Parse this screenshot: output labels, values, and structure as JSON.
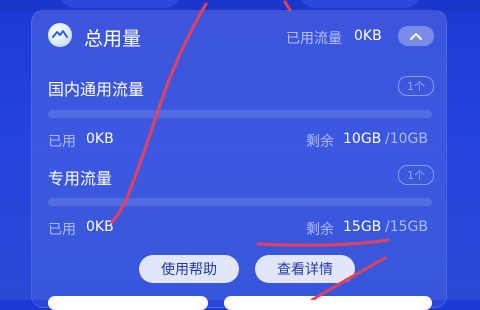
{
  "header": {
    "title": "总用量",
    "used_label": "已用流量",
    "used_value": "0KB",
    "collapse_icon": "chevron-up-icon"
  },
  "domestic": {
    "title": "国内通用流量",
    "count": "1个",
    "used_label": "已用",
    "used_value": "0KB",
    "remaining_label": "剩余",
    "remaining_value": "10GB",
    "total_value": "/10GB",
    "used_fraction": 0
  },
  "dedicated": {
    "title": "专用流量",
    "count": "1个",
    "used_label": "已用",
    "used_value": "0KB",
    "remaining_label": "剩余",
    "remaining_value": "15GB",
    "total_value": "/15GB",
    "used_fraction": 0
  },
  "actions": {
    "help_label": "使用帮助",
    "details_label": "查看详情"
  },
  "colors": {
    "background": "#2545de",
    "accent": "#3ec3ff",
    "scribble": "#e8405a"
  }
}
